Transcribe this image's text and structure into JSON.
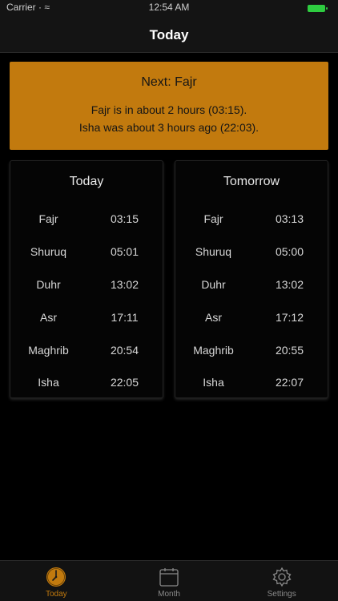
{
  "status_bar": {
    "carrier": "Carrier · ≈",
    "time": "12:54 AM"
  },
  "nav": {
    "title": "Today"
  },
  "banner": {
    "title": "Next: Fajr",
    "line1": "Fajr is in about 2 hours (03:15).",
    "line2": "Isha was about 3 hours ago (22:03)."
  },
  "today": {
    "title": "Today",
    "prayers": [
      {
        "name": "Fajr",
        "time": "03:15"
      },
      {
        "name": "Shuruq",
        "time": "05:01"
      },
      {
        "name": "Duhr",
        "time": "13:02"
      },
      {
        "name": "Asr",
        "time": "17:11"
      },
      {
        "name": "Maghrib",
        "time": "20:54"
      },
      {
        "name": "Isha",
        "time": "22:05"
      }
    ]
  },
  "tomorrow": {
    "title": "Tomorrow",
    "prayers": [
      {
        "name": "Fajr",
        "time": "03:13"
      },
      {
        "name": "Shuruq",
        "time": "05:00"
      },
      {
        "name": "Duhr",
        "time": "13:02"
      },
      {
        "name": "Asr",
        "time": "17:12"
      },
      {
        "name": "Maghrib",
        "time": "20:55"
      },
      {
        "name": "Isha",
        "time": "22:07"
      }
    ]
  },
  "tabs": [
    {
      "label": "Today",
      "icon": "clock-icon",
      "active": true
    },
    {
      "label": "Month",
      "icon": "calendar-icon",
      "active": false
    },
    {
      "label": "Settings",
      "icon": "gear-icon",
      "active": false
    }
  ],
  "colors": {
    "accent": "#c27a0e",
    "background": "#000000"
  }
}
